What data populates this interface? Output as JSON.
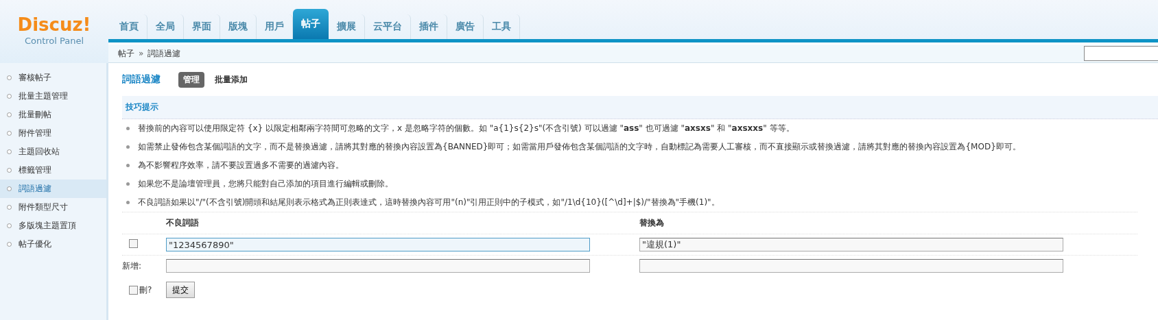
{
  "logo": {
    "title": "Discuz!",
    "subtitle": "Control Panel"
  },
  "tabs": [
    {
      "label": "首頁",
      "selected": false
    },
    {
      "label": "全局",
      "selected": false
    },
    {
      "label": "界面",
      "selected": false
    },
    {
      "label": "版塊",
      "selected": false
    },
    {
      "label": "用戶",
      "selected": false
    },
    {
      "label": "帖子",
      "selected": true
    },
    {
      "label": "擴展",
      "selected": false
    },
    {
      "label": "云平台",
      "selected": false
    },
    {
      "label": "插件",
      "selected": false
    },
    {
      "label": "廣告",
      "selected": false
    },
    {
      "label": "工具",
      "selected": false
    }
  ],
  "breadcrumb": {
    "items": [
      "帖子",
      "詞語過濾"
    ],
    "separator": "»"
  },
  "sidebar": {
    "items": [
      {
        "label": "審核帖子",
        "selected": false
      },
      {
        "label": "批量主題管理",
        "selected": false
      },
      {
        "label": "批量刪帖",
        "selected": false
      },
      {
        "label": "附件管理",
        "selected": false
      },
      {
        "label": "主題回收站",
        "selected": false
      },
      {
        "label": "標籤管理",
        "selected": false
      },
      {
        "label": "詞語過濾",
        "selected": true
      },
      {
        "label": "附件類型尺寸",
        "selected": false
      },
      {
        "label": "多版塊主題置頂",
        "selected": false
      },
      {
        "label": "帖子優化",
        "selected": false
      }
    ]
  },
  "page": {
    "title": "詞語過濾",
    "subtabs": [
      {
        "label": "管理",
        "selected": true
      },
      {
        "label": "批量添加",
        "selected": false
      }
    ]
  },
  "tips": {
    "title": "技巧提示",
    "items": [
      "替換前的內容可以使用限定符 {x} 以限定相鄰兩字符間可忽略的文字，x 是忽略字符的個數。如 \"a{1}s{2}s\"(不含引號) 可以過濾 \"**ass**\" 也可過濾 \"**axsxs**\" 和 \"**axsxxs**\" 等等。",
      "如需禁止發佈包含某個詞語的文字，而不是替換過濾，請將其對應的替換內容設置為{BANNED}即可；如需當用戶發佈包含某個詞語的文字時，自動標記為需要人工審核，而不直接顯示或替換過濾，請將其對應的替換內容設置為{MOD}即可。",
      "為不影響程序效率，請不要設置過多不需要的過濾內容。",
      "如果您不是論壇管理員，您將只能對自己添加的項目進行編輯或刪除。",
      "不良詞語如果以\"/\"(不含引號)開頭和結尾則表示格式為正則表達式，這時替換內容可用\"(n)\"引用正則中的子模式，如\"/1\\d{10}([^\\d]+|$)/\"替換為\"手機(1)\"。"
    ]
  },
  "table": {
    "columns": [
      "不良詞語",
      "替換為"
    ],
    "rows": [
      {
        "checked": false,
        "find": {
          "value": "\"1234567890\"",
          "focused": true
        },
        "replace": {
          "value": "\"違規(1)\"",
          "focused": false
        }
      }
    ],
    "new_row": {
      "label": "新增:"
    },
    "footer": {
      "delete_label": "刪?",
      "delete_checked": false,
      "submit": "提交"
    }
  }
}
